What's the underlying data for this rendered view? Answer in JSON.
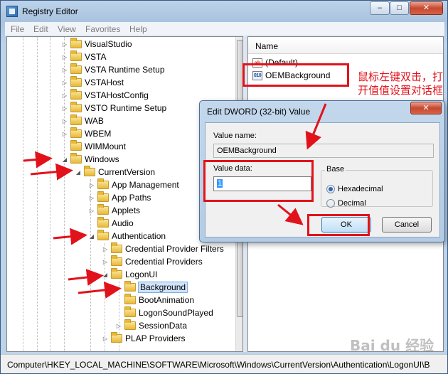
{
  "window": {
    "title": "Registry Editor",
    "caption_buttons": {
      "minimize": "–",
      "maximize": "□",
      "close": "✕"
    }
  },
  "menu": [
    "File",
    "Edit",
    "View",
    "Favorites",
    "Help"
  ],
  "tree": [
    {
      "label": "VisualStudio",
      "expander": "▷"
    },
    {
      "label": "VSTA",
      "expander": "▷"
    },
    {
      "label": "VSTA Runtime Setup",
      "expander": "▷"
    },
    {
      "label": "VSTAHost",
      "expander": "▷"
    },
    {
      "label": "VSTAHostConfig",
      "expander": "▷"
    },
    {
      "label": "VSTO Runtime Setup",
      "expander": "▷"
    },
    {
      "label": "WAB",
      "expander": "▷"
    },
    {
      "label": "WBEM",
      "expander": "▷"
    },
    {
      "label": "WIMMount",
      "expander": ""
    },
    {
      "label": "Windows",
      "expander": "◢"
    },
    {
      "label": "CurrentVersion",
      "expander": "◢"
    },
    {
      "label": "App Management",
      "expander": "▷"
    },
    {
      "label": "App Paths",
      "expander": "▷"
    },
    {
      "label": "Applets",
      "expander": "▷"
    },
    {
      "label": "Audio",
      "expander": ""
    },
    {
      "label": "Authentication",
      "expander": "◢"
    },
    {
      "label": "Credential Provider Filters",
      "expander": "▷"
    },
    {
      "label": "Credential Providers",
      "expander": "▷"
    },
    {
      "label": "LogonUI",
      "expander": "◢"
    },
    {
      "label": "Background",
      "expander": "",
      "selected": true
    },
    {
      "label": "BootAnimation",
      "expander": ""
    },
    {
      "label": "LogonSoundPlayed",
      "expander": ""
    },
    {
      "label": "SessionData",
      "expander": "▷"
    },
    {
      "label": "PLAP Providers",
      "expander": "▷"
    }
  ],
  "list": {
    "column_name": "Name",
    "rows": [
      {
        "icon": "ab",
        "name": "(Default)"
      },
      {
        "icon": "010",
        "name": "OEMBackground"
      }
    ]
  },
  "status": "Computer\\HKEY_LOCAL_MACHINE\\SOFTWARE\\Microsoft\\Windows\\CurrentVersion\\Authentication\\LogonUI\\B",
  "dialog": {
    "title": "Edit DWORD (32-bit) Value",
    "close": "✕",
    "value_name_label": "Value name:",
    "value_name": "OEMBackground",
    "value_data_label": "Value data:",
    "value_data": "1",
    "base_label": "Base",
    "radio_hex": "Hexadecimal",
    "radio_dec": "Decimal",
    "ok": "OK",
    "cancel": "Cancel"
  },
  "annotation": "鼠标左键双击，打开值值设置对话框",
  "watermark": "Bai du 经验",
  "colors": {
    "annotation_red": "#e2121b",
    "selection": "#cfe3fb"
  }
}
